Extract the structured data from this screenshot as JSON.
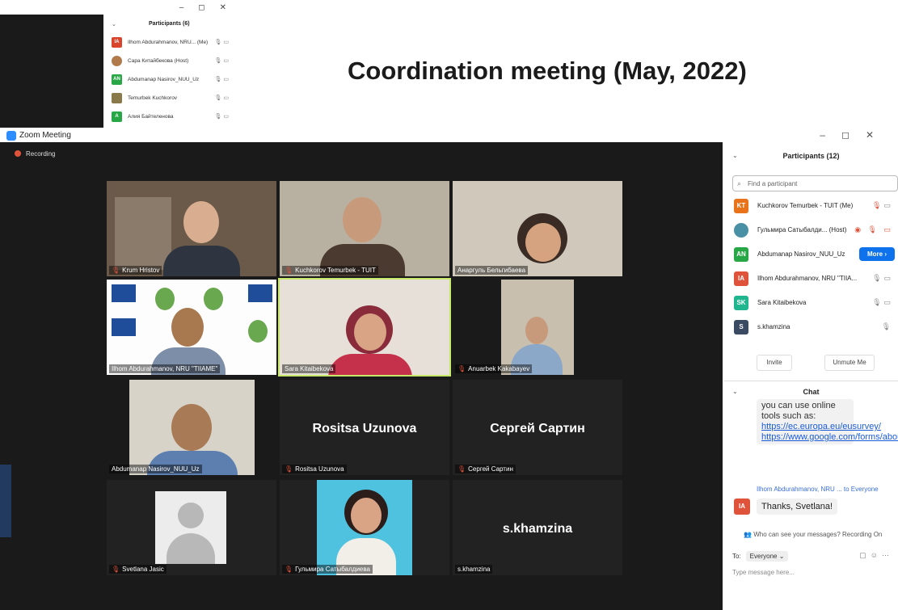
{
  "slide_title": "Coordination meeting (May, 2022)",
  "small_window": {
    "controls": [
      "–",
      "◻",
      "✕"
    ],
    "title": "Participants (6)",
    "participants": [
      {
        "initials": "IA",
        "name": "Ilhom Abdurahmanov, NRU... (Me)",
        "color": "#d9442c"
      },
      {
        "initials": "",
        "name": "Сара Китайбекова (Host)",
        "color": "#b07a4b"
      },
      {
        "initials": "AN",
        "name": "Abdumanap Nasirov_NUU_Uz",
        "color": "#27a745"
      },
      {
        "initials": "",
        "name": "Temurbek Kuchkorov",
        "color": "#8a7a4a"
      },
      {
        "initials": "A",
        "name": "Алия Байтеленова",
        "color": "#27a745"
      }
    ]
  },
  "window": {
    "title": "Zoom Meeting",
    "controls": [
      "–",
      "◻",
      "✕"
    ],
    "recording": "Recording"
  },
  "tiles": [
    {
      "name": "Krum Hristov",
      "muted": true
    },
    {
      "name": "Kuchkorov Temurbek - TUIT",
      "muted": true
    },
    {
      "name": "Анаргуль Бельгибаева",
      "muted": false
    },
    {
      "name": "Ilhom Abdurahmanov, NRU \"TIIAME\"",
      "muted": false
    },
    {
      "name": "Sara Kitaibekova",
      "muted": false
    },
    {
      "name": "Anuarbek Kakabayev",
      "muted": true
    },
    {
      "name": "Abdumanap Nasirov_NUU_Uz",
      "muted": false
    },
    {
      "name": "Rositsa Uzunova",
      "muted": true,
      "display_name": "Rositsa Uzunova"
    },
    {
      "name": "Сергей Сартин",
      "muted": true,
      "display_name": "Сергей Сартин"
    },
    {
      "name": "Svetlana Jasic",
      "muted": true
    },
    {
      "name": "Гульмира Сатыбалдиева",
      "muted": true
    },
    {
      "name": "s.khamzina",
      "muted": false,
      "display_name": "s.khamzina"
    }
  ],
  "participants_panel": {
    "title": "Participants (12)",
    "search_placeholder": "Find a participant",
    "rows": [
      {
        "initials": "KT",
        "name": "Kuchkorov Temurbek - TUIT (Me)",
        "color": "#e8731a"
      },
      {
        "initials": "",
        "name": "Гульмира Сатыбалди... (Host)",
        "color": "#4a90a4"
      },
      {
        "initials": "AN",
        "name": "Abdumanap Nasirov_NUU_Uz",
        "color": "#27a745"
      },
      {
        "initials": "IA",
        "name": "Ilhom Abdurahmanov, NRU \"TIIA...",
        "color": "#e0533b"
      },
      {
        "initials": "SK",
        "name": "Sara Kitaibekova",
        "color": "#1fb58f"
      },
      {
        "initials": "S",
        "name": "s.khamzina",
        "color": "#3a4a63"
      }
    ],
    "more_button": "More ›",
    "invite": "Invite",
    "unmute": "Unmute Me"
  },
  "chat": {
    "title": "Chat",
    "message_text": "you can use online tools such as:",
    "link1": "https://ec.europa.eu/eusurvey/",
    "link2": "https://www.google.com/forms/about/",
    "sender": "Ilhom Abdurahmanov, NRU ... to Everyone",
    "sender_initials": "IA",
    "message2": "Thanks, Svetlana!",
    "visibility_note": "Who can see your messages? Recording On",
    "to_label": "To:",
    "to_value": "Everyone ⌄",
    "input_placeholder": "Type message here..."
  }
}
